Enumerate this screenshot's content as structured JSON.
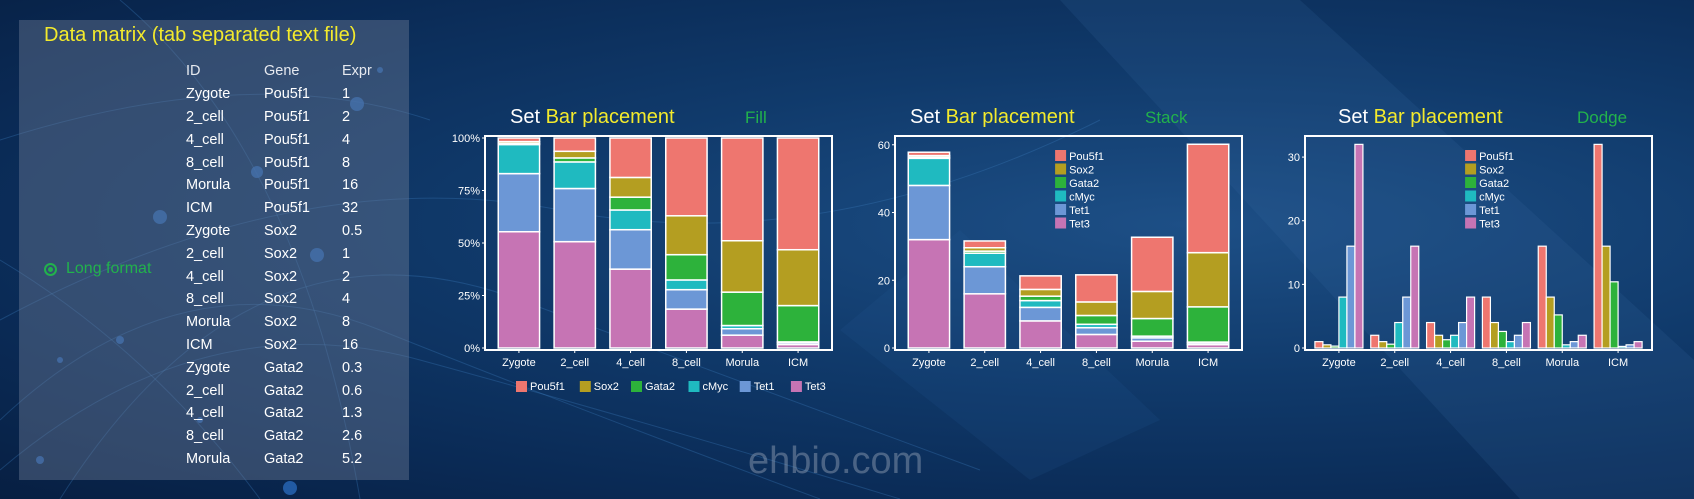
{
  "panel": {
    "title": "Data matrix (tab separated text file)",
    "format_label": "Long format",
    "headers": {
      "id": "ID",
      "gene": "Gene",
      "expr": "Expr"
    },
    "rows": [
      {
        "id": "Zygote",
        "gene": "Pou5f1",
        "expr": "1"
      },
      {
        "id": "2_cell",
        "gene": "Pou5f1",
        "expr": "2"
      },
      {
        "id": "4_cell",
        "gene": "Pou5f1",
        "expr": "4"
      },
      {
        "id": "8_cell",
        "gene": "Pou5f1",
        "expr": "8"
      },
      {
        "id": "Morula",
        "gene": "Pou5f1",
        "expr": "16"
      },
      {
        "id": "ICM",
        "gene": "Pou5f1",
        "expr": "32"
      },
      {
        "id": "Zygote",
        "gene": "Sox2",
        "expr": "0.5"
      },
      {
        "id": "2_cell",
        "gene": "Sox2",
        "expr": "1"
      },
      {
        "id": "4_cell",
        "gene": "Sox2",
        "expr": "2"
      },
      {
        "id": "8_cell",
        "gene": "Sox2",
        "expr": "4"
      },
      {
        "id": "Morula",
        "gene": "Sox2",
        "expr": "8"
      },
      {
        "id": "ICM",
        "gene": "Sox2",
        "expr": "16"
      },
      {
        "id": "Zygote",
        "gene": "Gata2",
        "expr": "0.3"
      },
      {
        "id": "2_cell",
        "gene": "Gata2",
        "expr": "0.6"
      },
      {
        "id": "4_cell",
        "gene": "Gata2",
        "expr": "1.3"
      },
      {
        "id": "8_cell",
        "gene": "Gata2",
        "expr": "2.6"
      },
      {
        "id": "Morula",
        "gene": "Gata2",
        "expr": "5.2"
      }
    ]
  },
  "watermark": "ehbio.com",
  "colors": {
    "Pou5f1": "#ee766f",
    "Sox2": "#b49e21",
    "Gata2": "#2db23b",
    "cMyc": "#1fbac0",
    "Tet1": "#6c97d6",
    "Tet3": "#c674b4"
  },
  "chart_data": [
    {
      "type": "bar",
      "position": "fill",
      "heading": {
        "set": "Set",
        "bar": "Bar placement",
        "mode": "Fill"
      },
      "categories": [
        "Zygote",
        "2_cell",
        "4_cell",
        "8_cell",
        "Morula",
        "ICM"
      ],
      "y_ticks": [
        "0%",
        "25%",
        "50%",
        "75%",
        "100%"
      ],
      "ylim": [
        0,
        1
      ],
      "legend": "bottom",
      "series": [
        {
          "name": "Pou5f1",
          "values": [
            1,
            2,
            4,
            8,
            16,
            32
          ]
        },
        {
          "name": "Sox2",
          "values": [
            0.5,
            1,
            2,
            4,
            8,
            16
          ]
        },
        {
          "name": "Gata2",
          "values": [
            0.3,
            0.6,
            1.3,
            2.6,
            5.2,
            10.4
          ]
        },
        {
          "name": "cMyc",
          "values": [
            8,
            4,
            2,
            1,
            0.5,
            0.25
          ]
        },
        {
          "name": "Tet1",
          "values": [
            16,
            8,
            4,
            2,
            1,
            0.5
          ]
        },
        {
          "name": "Tet3",
          "values": [
            32,
            16,
            8,
            4,
            2,
            1
          ]
        }
      ]
    },
    {
      "type": "bar",
      "position": "stack",
      "heading": {
        "set": "Set",
        "bar": "Bar placement",
        "mode": "Stack"
      },
      "categories": [
        "Zygote",
        "2_cell",
        "4_cell",
        "8_cell",
        "Morula",
        "ICM"
      ],
      "y_ticks": [
        "0",
        "20",
        "40",
        "60"
      ],
      "ylim": [
        0,
        62
      ],
      "legend": "top-center",
      "series": [
        {
          "name": "Pou5f1",
          "values": [
            1,
            2,
            4,
            8,
            16,
            32
          ]
        },
        {
          "name": "Sox2",
          "values": [
            0.5,
            1,
            2,
            4,
            8,
            16
          ]
        },
        {
          "name": "Gata2",
          "values": [
            0.3,
            0.6,
            1.3,
            2.6,
            5.2,
            10.4
          ]
        },
        {
          "name": "cMyc",
          "values": [
            8,
            4,
            2,
            1,
            0.5,
            0.25
          ]
        },
        {
          "name": "Tet1",
          "values": [
            16,
            8,
            4,
            2,
            1,
            0.5
          ]
        },
        {
          "name": "Tet3",
          "values": [
            32,
            16,
            8,
            4,
            2,
            1
          ]
        }
      ]
    },
    {
      "type": "bar",
      "position": "dodge",
      "heading": {
        "set": "Set",
        "bar": "Bar placement",
        "mode": "Dodge"
      },
      "categories": [
        "Zygote",
        "2_cell",
        "4_cell",
        "8_cell",
        "Morula",
        "ICM"
      ],
      "y_ticks": [
        "0",
        "10",
        "20",
        "30"
      ],
      "ylim": [
        0,
        33
      ],
      "legend": "top-center",
      "series": [
        {
          "name": "Pou5f1",
          "values": [
            1,
            2,
            4,
            8,
            16,
            32
          ]
        },
        {
          "name": "Sox2",
          "values": [
            0.5,
            1,
            2,
            4,
            8,
            16
          ]
        },
        {
          "name": "Gata2",
          "values": [
            0.3,
            0.6,
            1.3,
            2.6,
            5.2,
            10.4
          ]
        },
        {
          "name": "cMyc",
          "values": [
            8,
            4,
            2,
            1,
            0.5,
            0.25
          ]
        },
        {
          "name": "Tet1",
          "values": [
            16,
            8,
            4,
            2,
            1,
            0.5
          ]
        },
        {
          "name": "Tet3",
          "values": [
            32,
            16,
            8,
            4,
            2,
            1
          ]
        }
      ]
    }
  ]
}
